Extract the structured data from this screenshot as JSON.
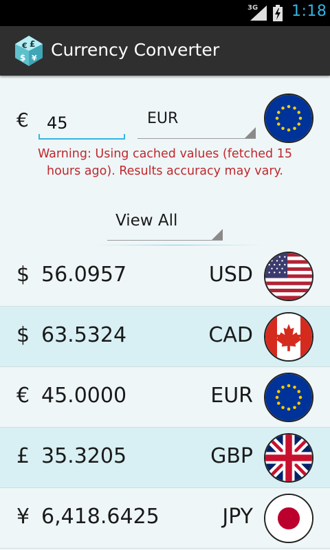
{
  "status_bar": {
    "network": "3G",
    "time": "1:18"
  },
  "app": {
    "title": "Currency Converter"
  },
  "input": {
    "symbol": "€",
    "amount": "45",
    "from_currency": "EUR"
  },
  "warning": "Warning: Using cached values (fetched 15 hours ago). Results accuracy may vary.",
  "filter": {
    "selected": "View All"
  },
  "results": [
    {
      "symbol": "$",
      "amount": "56.0957",
      "code": "USD",
      "flag_icon": "us-flag-icon"
    },
    {
      "symbol": "$",
      "amount": "63.5324",
      "code": "CAD",
      "flag_icon": "canada-flag-icon"
    },
    {
      "symbol": "€",
      "amount": "45.0000",
      "code": "EUR",
      "flag_icon": "eu-flag-icon"
    },
    {
      "symbol": "£",
      "amount": "35.3205",
      "code": "GBP",
      "flag_icon": "uk-flag-icon"
    },
    {
      "symbol": "¥",
      "amount": "6,418.6425",
      "code": "JPY",
      "flag_icon": "japan-flag-icon"
    }
  ],
  "colors": {
    "accent": "#33b5e5",
    "warning": "#c0272d",
    "action_bar": "#2f2f2f",
    "alt_row": "#d8f0f4"
  }
}
